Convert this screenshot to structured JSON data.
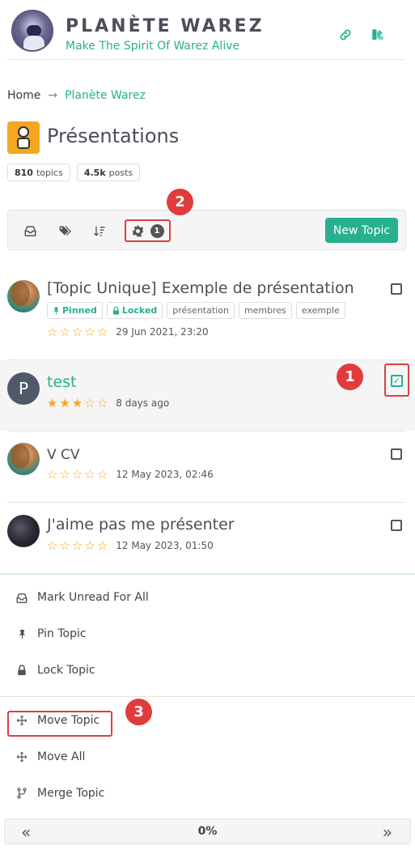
{
  "header": {
    "brand_title": "PLANÈTE WAREZ",
    "brand_tagline": "Make The Spirit Of Warez Alive",
    "link_icon": "link-icon",
    "theme_icon": "palette-icon"
  },
  "breadcrumb": {
    "home": "Home",
    "separator": "→",
    "current": "Planète Warez"
  },
  "category": {
    "title": "Présentations",
    "topics_count": "810",
    "topics_label": "topics",
    "posts_count": "4.5k",
    "posts_label": "posts"
  },
  "toolbar": {
    "tools_count": "1",
    "new_topic_label": "New Topic"
  },
  "markers": {
    "one": "1",
    "two": "2",
    "three": "3"
  },
  "topics": [
    {
      "title": "[Topic Unique] Exemple de présentation",
      "badges": [
        "Pinned",
        "Locked",
        "présentation",
        "membres",
        "exemple"
      ],
      "rating": 0,
      "time": "29 Jun 2021, 23:20",
      "selected": false
    },
    {
      "title": "test",
      "avatar_letter": "P",
      "rating": 3,
      "time": "8 days ago",
      "selected": true
    },
    {
      "title": "V CV",
      "rating": 0,
      "time": "12 May 2023, 02:46",
      "selected": false
    },
    {
      "title": "J'aime pas me présenter",
      "rating": 0,
      "time": "12 May 2023, 01:50",
      "selected": false
    }
  ],
  "tools_menu": {
    "mark_unread": "Mark Unread For All",
    "pin": "Pin Topic",
    "lock": "Lock Topic",
    "move": "Move Topic",
    "move_all": "Move All",
    "merge": "Merge Topic"
  },
  "pager": {
    "prev": "«",
    "percent": "0%",
    "next": "»"
  },
  "colors": {
    "accent": "#27b08f",
    "highlight": "#d94040",
    "star": "#f5a623"
  }
}
